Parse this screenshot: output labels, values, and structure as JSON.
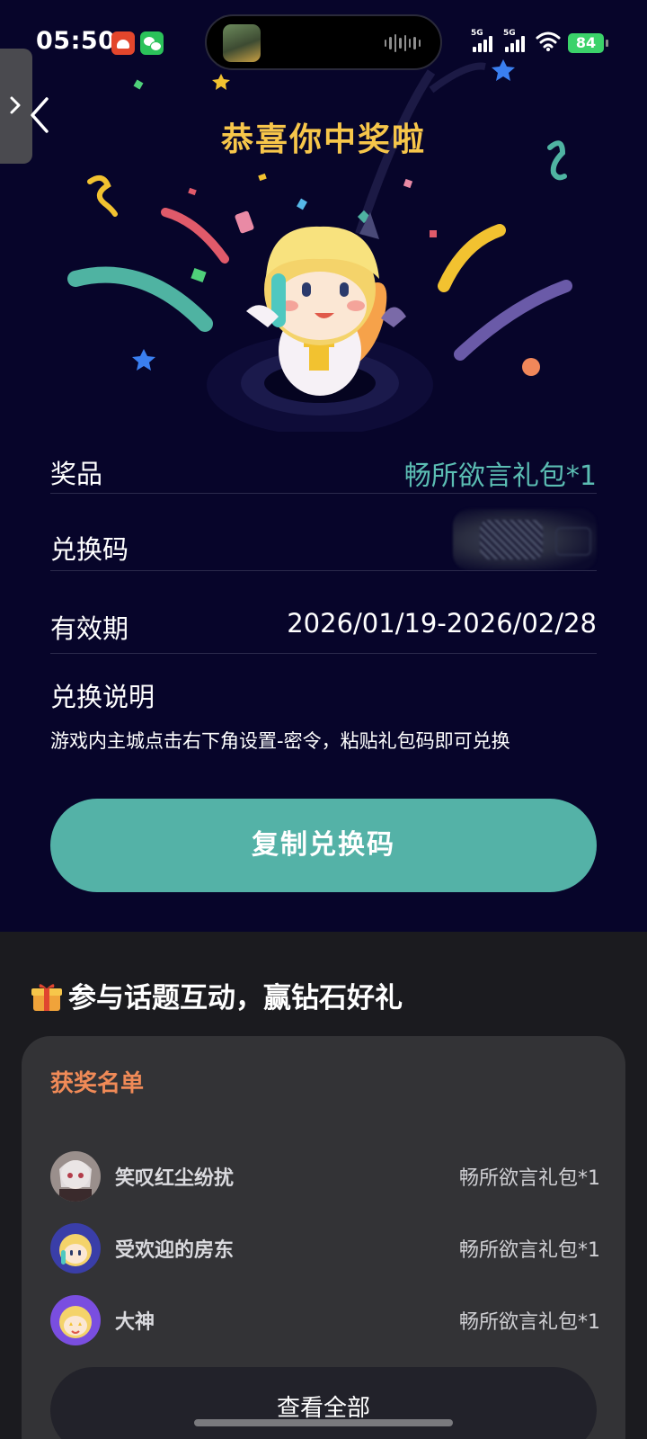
{
  "status_bar": {
    "time": "05:50",
    "signal1_tag": "5G",
    "signal2_tag": "5G",
    "battery": "84",
    "icons": [
      "app-notification-icon",
      "wechat-icon",
      "game-app-icon",
      "voice-wave-icon",
      "signal-icon",
      "wifi-icon",
      "battery-icon"
    ]
  },
  "header": {
    "title": "恭喜你中奖啦"
  },
  "info": {
    "prize_label": "奖品",
    "prize_value": "畅所欲言礼包*1",
    "code_label": "兑换码",
    "expire_label": "有效期",
    "expire_value": "2026/01/19-2026/02/28",
    "redeem_title": "兑换说明",
    "redeem_desc": "游戏内主城点击右下角设置-密令，粘贴礼包码即可兑换"
  },
  "copy_button": "复制兑换码",
  "topic": {
    "title": "参与话题互动，赢钻石好礼"
  },
  "winners": {
    "title": "获奖名单",
    "list": [
      {
        "name": "笑叹红尘纷扰",
        "prize": "畅所欲言礼包*1"
      },
      {
        "name": "受欢迎的房东",
        "prize": "畅所欲言礼包*1"
      },
      {
        "name": "大神",
        "prize": "畅所欲言礼包*1"
      }
    ],
    "view_all": "查看全部"
  },
  "colors": {
    "accent_teal": "#54b2a7",
    "title_gold": "#f7c64a",
    "winners_orange": "#f08a57",
    "background_navy": "#07052a"
  }
}
